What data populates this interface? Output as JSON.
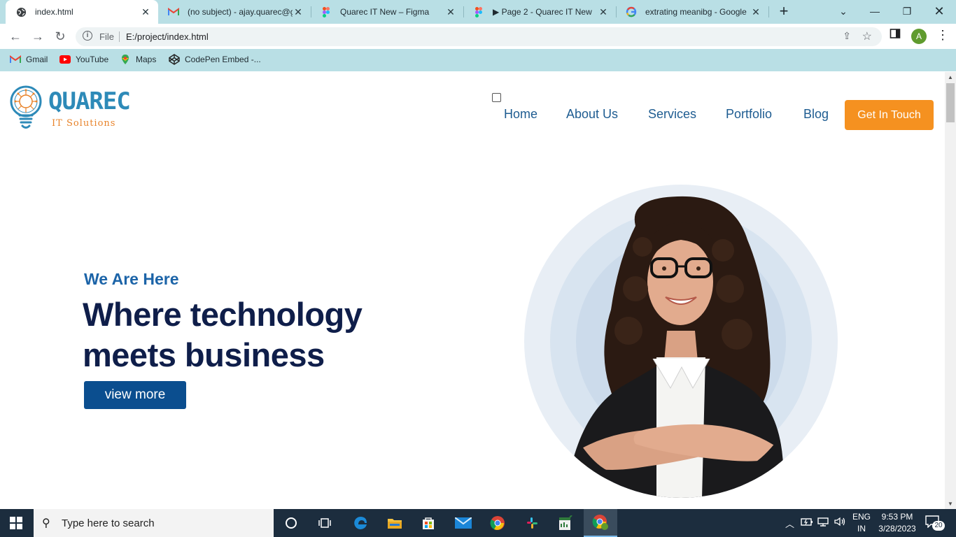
{
  "browser": {
    "tabs": [
      {
        "title": "index.html",
        "icon": "globe-icon",
        "active": true
      },
      {
        "title": "(no subject) - ajay.quarec@gmail",
        "icon": "gmail-icon",
        "active": false
      },
      {
        "title": "Quarec IT New – Figma",
        "icon": "figma-icon",
        "active": false
      },
      {
        "title": "▶ Page 2 - Quarec IT New",
        "icon": "figma-icon",
        "active": false
      },
      {
        "title": "extrating meanibg - Google",
        "icon": "google-icon",
        "active": false
      }
    ],
    "address": {
      "scheme": "File",
      "url": "E:/project/index.html"
    },
    "profile_initial": "A",
    "bookmarks": [
      {
        "label": "Gmail",
        "icon": "gmail-icon"
      },
      {
        "label": "YouTube",
        "icon": "youtube-icon"
      },
      {
        "label": "Maps",
        "icon": "maps-icon"
      },
      {
        "label": "CodePen Embed -...",
        "icon": "codepen-icon"
      }
    ]
  },
  "site": {
    "logo": {
      "name": "QUAREC",
      "tagline": "IT Solutions"
    },
    "nav": [
      "Home",
      "About Us",
      "Services",
      "Portfolio",
      "Blog"
    ],
    "cta": "Get In Touch",
    "hero": {
      "eyebrow": "We Are Here",
      "headline_line1": "Where technology",
      "headline_line2": "meets business",
      "button": "view more"
    }
  },
  "taskbar": {
    "search_placeholder": "Type here to search",
    "language": "ENG",
    "region": "IN",
    "time": "9:53 PM",
    "date": "3/28/2023",
    "notifications": "20"
  },
  "colors": {
    "browser_frame": "#b9dfe5",
    "nav_link": "#1e5c91",
    "cta": "#f59120",
    "headline": "#0f1e4a",
    "eyebrow": "#1c64a8",
    "button": "#0b4e8f",
    "taskbar": "#1c2d3e"
  }
}
